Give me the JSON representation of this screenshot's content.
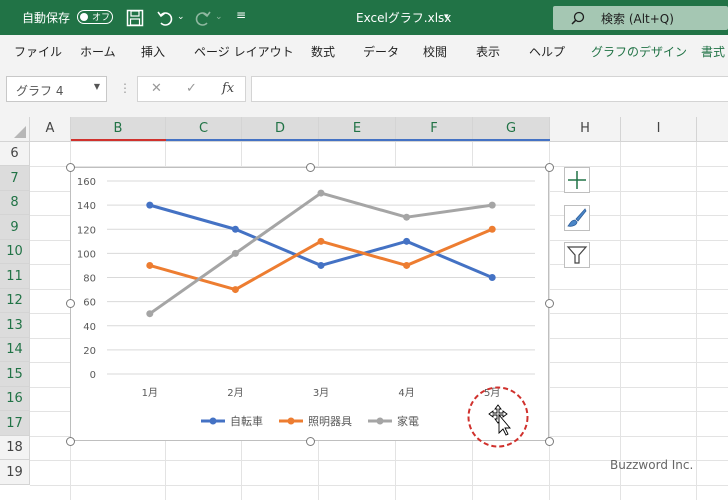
{
  "titlebar": {
    "autosave_label": "自動保存",
    "autosave_state": "オフ",
    "filename": "Excelグラフ.xlsx",
    "search_placeholder": "検索 (Alt+Q)"
  },
  "ribbon": {
    "tabs": [
      "ファイル",
      "ホーム",
      "挿入",
      "ページ レイアウト",
      "数式",
      "データ",
      "校閲",
      "表示",
      "ヘルプ",
      "グラフのデザイン",
      "書式"
    ]
  },
  "formula_bar": {
    "name_box": "グラフ 4",
    "fx": "fx",
    "cancel": "✕",
    "enter": "✓",
    "value": ""
  },
  "sheet": {
    "columns": [
      "A",
      "B",
      "C",
      "D",
      "E",
      "F",
      "G",
      "H",
      "I"
    ],
    "rows": [
      "6",
      "7",
      "8",
      "9",
      "10",
      "11",
      "12",
      "13",
      "14",
      "15",
      "16",
      "17",
      "18",
      "19"
    ]
  },
  "chart_data": {
    "type": "line",
    "categories": [
      "1月",
      "2月",
      "3月",
      "4月",
      "5月"
    ],
    "series": [
      {
        "name": "自転車",
        "values": [
          140,
          120,
          90,
          110,
          80
        ],
        "color": "#4472c4"
      },
      {
        "name": "照明器具",
        "values": [
          90,
          70,
          110,
          90,
          120
        ],
        "color": "#ed7d31"
      },
      {
        "name": "家電",
        "values": [
          50,
          100,
          150,
          130,
          140
        ],
        "color": "#a5a5a5"
      }
    ],
    "yticks": [
      "0",
      "20",
      "40",
      "60",
      "80",
      "100",
      "120",
      "140",
      "160"
    ],
    "ylim": [
      0,
      160
    ],
    "grid": true,
    "legend_position": "bottom",
    "title": "",
    "xlabel": "",
    "ylabel": ""
  },
  "colors": {
    "accent_green": "#217346",
    "cursor_circle": "#d0312d"
  },
  "watermark": "Buzzword Inc."
}
